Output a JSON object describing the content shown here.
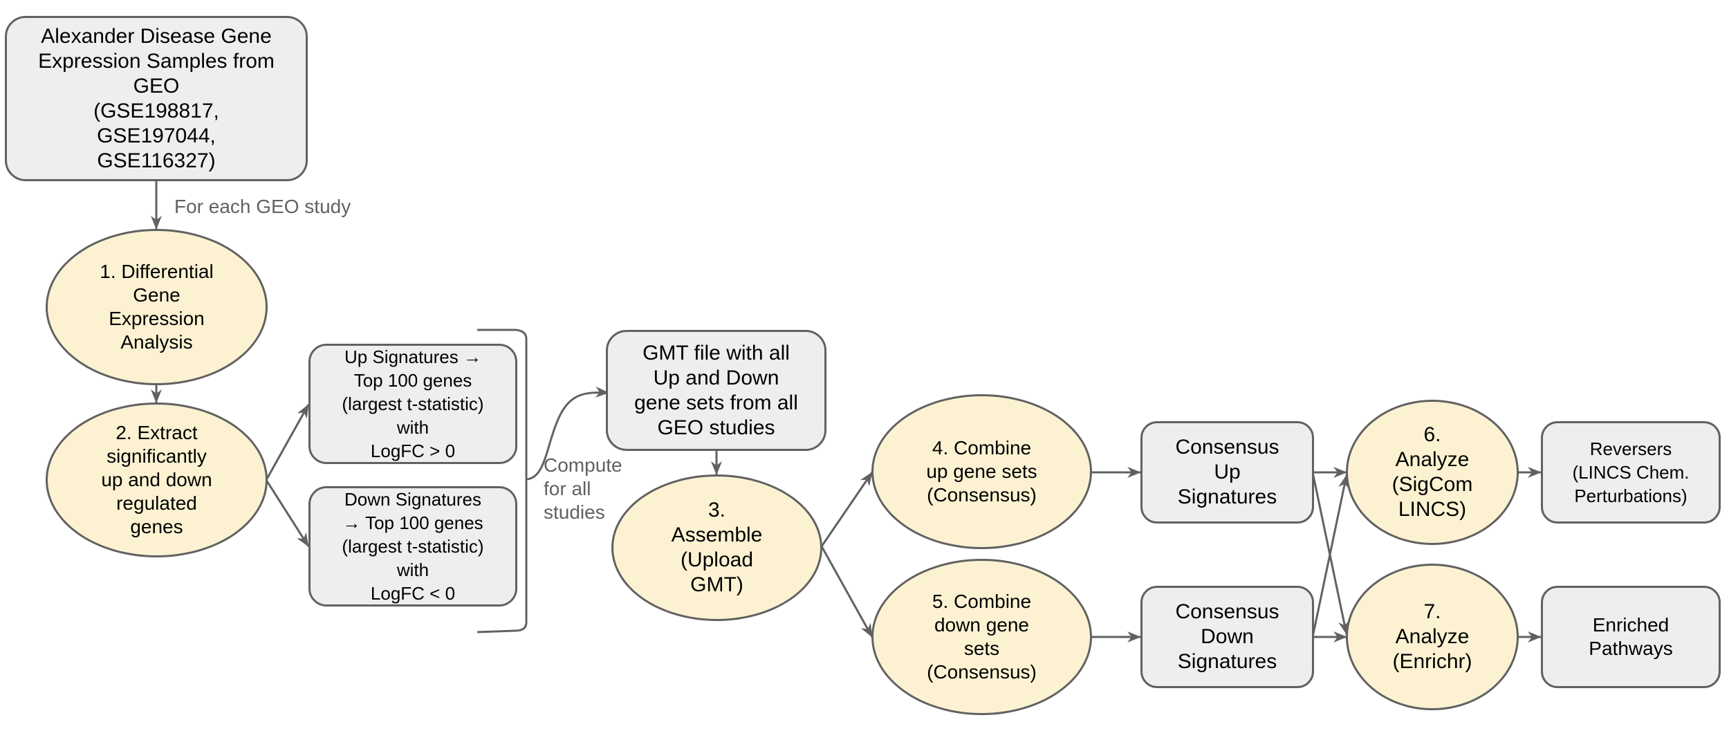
{
  "diagram": {
    "nodes": {
      "source": "Alexander Disease Gene\nExpression Samples from\nGEO\n(GSE198817,\nGSE197044,\nGSE116327)",
      "step1": "1. Differential\nGene\nExpression\nAnalysis",
      "step2": "2. Extract\nsignificantly\nup and down\nregulated\ngenes",
      "up_signatures": "Up Signatures →\nTop 100 genes\n(largest t-statistic)\nwith\nLogFC > 0",
      "down_signatures": "Down Signatures\n→ Top 100 genes\n(largest t-statistic)\nwith\nLogFC < 0",
      "gmt_file": "GMT file with all\nUp and Down\ngene sets from all\nGEO studies",
      "step3": "3.\nAssemble\n(Upload\nGMT)",
      "step4": "4. Combine\nup gene sets\n(Consensus)",
      "step5": "5. Combine\ndown gene\nsets\n(Consensus)",
      "consensus_up": "Consensus\nUp\nSignatures",
      "consensus_down": "Consensus\nDown\nSignatures",
      "step6": "6.\nAnalyze\n(SigCom\nLINCS)",
      "step7": "7.\nAnalyze\n(Enrichr)",
      "reversers": "Reversers\n(LINCS Chem.\nPerturbations)",
      "enriched": "Enriched\nPathways"
    },
    "edge_labels": {
      "for_each": "For each GEO study",
      "compute_all": "Compute\nfor all\nstudies"
    },
    "colors": {
      "process_fill": "#fcf2d2",
      "data_fill": "#eeeeee",
      "stroke": "#616161"
    }
  }
}
